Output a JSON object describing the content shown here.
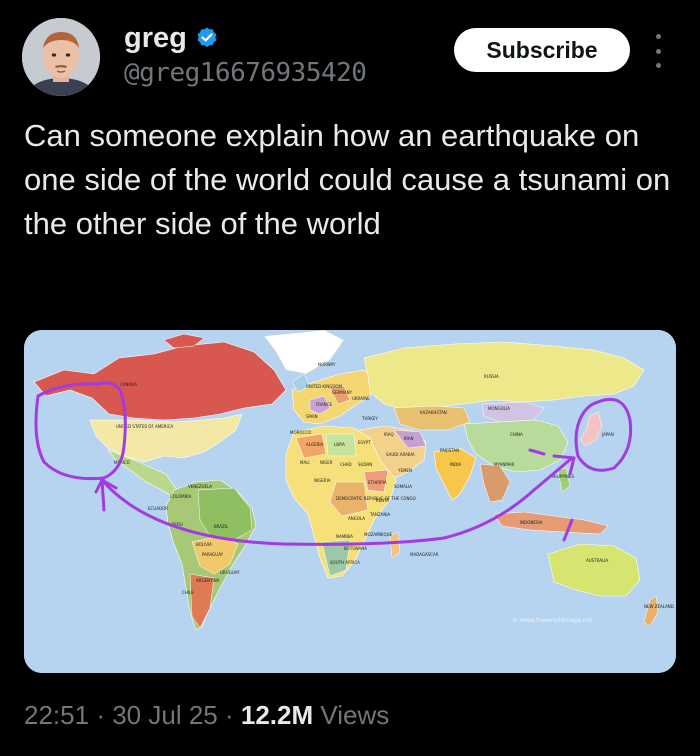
{
  "post": {
    "author": {
      "display_name": "greg",
      "handle": "@greg16676935420",
      "verified": true,
      "verified_color": "#1d9bf0"
    },
    "subscribe_label": "Subscribe",
    "text": "Can someone explain how an earthquake on one side of the world could cause a tsunami on the other side of the world",
    "meta": {
      "time": "22:51",
      "separator": "·",
      "date": "30 Jul 25",
      "views_count": "12.2M",
      "views_label": "Views"
    }
  },
  "map": {
    "watermark": "© www.freeworldmaps.net",
    "country_labels": {
      "canada": "CANADA",
      "usa": "UNITED STATES OF AMERICA",
      "mexico": "MEXICO",
      "venezuela": "VENEZUELA",
      "colombia": "COLOMBIA",
      "ecuador": "ECUADOR",
      "peru": "PERU",
      "brazil": "BRAZIL",
      "bolivia": "BOLIVIA",
      "paraguay": "PARAGUAY",
      "chile": "CHILE",
      "argentina": "ARGENTINA",
      "uruguay": "URUGUAY",
      "norway": "NORWAY",
      "uk": "UNITED KINGDOM",
      "france": "FRANCE",
      "spain": "SPAIN",
      "germany": "GERMANY",
      "ukraine": "UKRAINE",
      "turkey": "TURKEY",
      "iraq": "IRAQ",
      "iran": "IRAN",
      "morocco": "MOROCCO",
      "algeria": "ALGERIA",
      "libya": "LIBYA",
      "egypt": "EGYPT",
      "mali": "MALI",
      "niger": "NIGER",
      "chad": "CHAD",
      "sudan": "SUDAN",
      "nigeria": "NIGERIA",
      "ethiopia": "ETHIOPIA",
      "somalia": "SOMALIA",
      "kenya": "KENYA",
      "drc": "DEMOCRATIC REPUBLIC OF THE CONGO",
      "angola": "ANGOLA",
      "tanzania": "TANZANIA",
      "namibia": "NAMIBIA",
      "botswana": "BOTSWANA",
      "south_africa": "SOUTH AFRICA",
      "madagascar": "MADAGASCAR",
      "mozambique": "MOZAMBIQUE",
      "saudi_arabia": "SAUDI ARABIA",
      "yemen": "YEMEN",
      "russia": "RUSSIA",
      "kazakhstan": "KAZAKHSTAN",
      "mongolia": "MONGOLIA",
      "china": "CHINA",
      "pakistan": "PAKISTAN",
      "india": "INDIA",
      "myanmar": "MYANMAR",
      "indonesia": "INDONESIA",
      "philippines": "PHILIPPINES",
      "japan": "JAPAN",
      "australia": "AUSTRALIA",
      "new_zealand": "NEW ZEALAND"
    },
    "colors": {
      "ocean": "#b6d3ef",
      "canada": "#d8574f",
      "usa": "#f4e8a6",
      "greenland": "#ffffff",
      "russia": "#ede98a",
      "annotation": "#a23be0"
    }
  }
}
